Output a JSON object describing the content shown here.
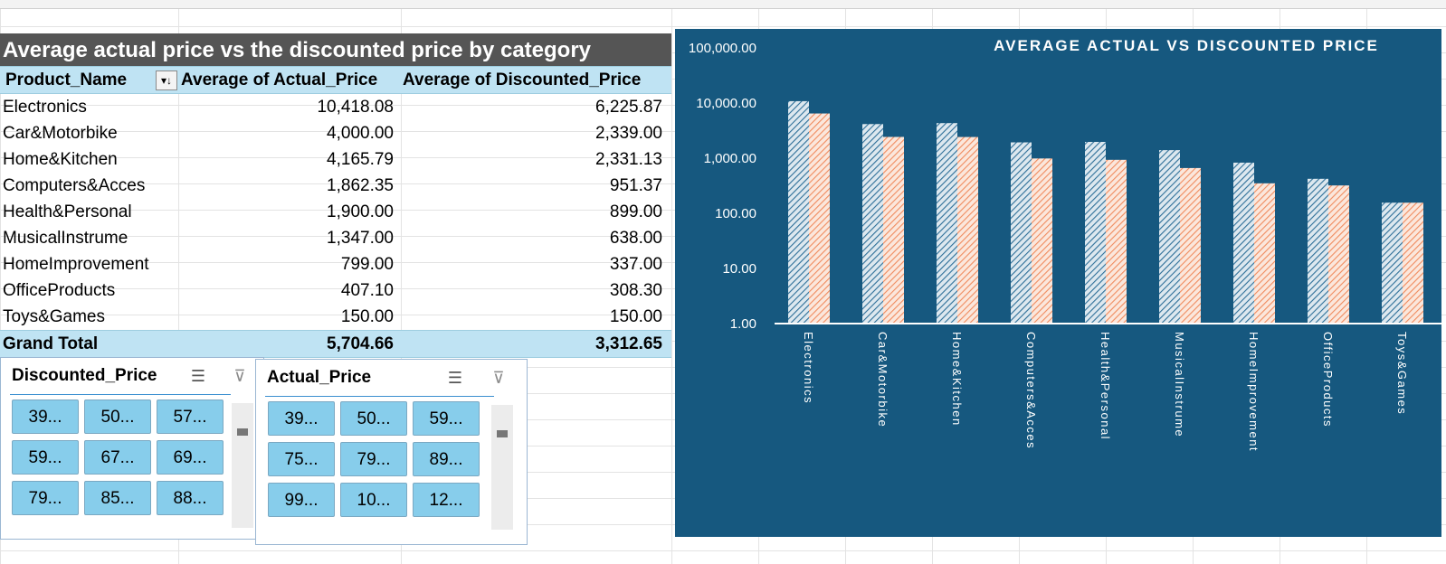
{
  "pivot": {
    "title": "Average actual price vs the discounted price by category",
    "headers": [
      "Product_Name",
      "Average of Actual_Price",
      "Average of Discounted_Price"
    ],
    "sort_icon": "sort-descending-icon",
    "rows": [
      {
        "name": "Electronics",
        "actual": "10,418.08",
        "discounted": "6,225.87"
      },
      {
        "name": "Car&Motorbike",
        "actual": "4,000.00",
        "discounted": "2,339.00"
      },
      {
        "name": "Home&Kitchen",
        "actual": "4,165.79",
        "discounted": "2,331.13"
      },
      {
        "name": "Computers&Acces",
        "actual": "1,862.35",
        "discounted": "951.37"
      },
      {
        "name": "Health&Personal",
        "actual": "1,900.00",
        "discounted": "899.00"
      },
      {
        "name": "MusicalInstrume",
        "actual": "1,347.00",
        "discounted": "638.00"
      },
      {
        "name": "HomeImprovement",
        "actual": "799.00",
        "discounted": "337.00"
      },
      {
        "name": "OfficeProducts",
        "actual": "407.10",
        "discounted": "308.30"
      },
      {
        "name": "Toys&Games",
        "actual": "150.00",
        "discounted": "150.00"
      }
    ],
    "total": {
      "name": "Grand Total",
      "actual": "5,704.66",
      "discounted": "3,312.65"
    }
  },
  "slicers": {
    "discounted": {
      "title": "Discounted_Price",
      "items": [
        "39...",
        "50...",
        "57...",
        "59...",
        "67...",
        "69...",
        "79...",
        "85...",
        "88..."
      ],
      "multiselect_icon": "multi-select-icon",
      "clear_icon": "clear-filter-icon"
    },
    "actual": {
      "title": "Actual_Price",
      "items": [
        "39...",
        "50...",
        "59...",
        "75...",
        "79...",
        "89...",
        "99...",
        "10...",
        "12..."
      ],
      "multiselect_icon": "multi-select-icon",
      "clear_icon": "clear-filter-icon"
    }
  },
  "chart_data": {
    "type": "bar",
    "title": "AVERAGE ACTUAL VS DISCOUNTED PRICE",
    "y_scale": "log",
    "ylim": [
      1,
      100000
    ],
    "y_tick_labels": [
      "100,000.00",
      "10,000.00",
      "1,000.00",
      "100.00",
      "10.00",
      "1.00"
    ],
    "categories": [
      "Electronics",
      "Car&Motorbike",
      "Home&Kitchen",
      "Computers&Acces",
      "Health&Personal",
      "MusicalInstrume",
      "HomeImprovement",
      "OfficeProducts",
      "Toys&Games"
    ],
    "series": [
      {
        "values": [
          10418.08,
          4000.0,
          4165.79,
          1862.35,
          1900.0,
          1347.0,
          799.0,
          407.1,
          150.0
        ],
        "color": "#2d6f98",
        "pattern": "diagonal-hatch-light"
      },
      {
        "values": [
          6225.87,
          2339.0,
          2331.13,
          951.37,
          899.0,
          638.0,
          337.0,
          308.3,
          150.0
        ],
        "color": "#f08b5e",
        "pattern": "diagonal-hatch-orange"
      }
    ],
    "background": "#16587f",
    "grid": false,
    "legend": "none"
  }
}
